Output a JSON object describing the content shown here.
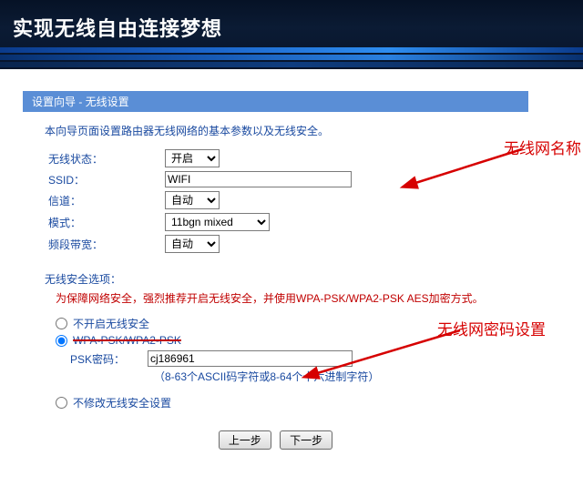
{
  "banner": {
    "slogan": "实现无线自由连接梦想"
  },
  "panel": {
    "title": "设置向导 - 无线设置",
    "intro": "本向导页面设置路由器无线网络的基本参数以及无线安全。"
  },
  "form": {
    "wireless_status_label": "无线状态：",
    "wireless_status_value": "开启",
    "ssid_label": "SSID：",
    "ssid_value": "WIFI",
    "channel_label": "信道：",
    "channel_value": "自动",
    "mode_label": "模式：",
    "mode_value": "11bgn mixed",
    "bandwidth_label": "频段带宽：",
    "bandwidth_value": "自动"
  },
  "security": {
    "title": "无线安全选项：",
    "warning": "为保障网络安全，强烈推荐开启无线安全，并使用WPA-PSK/WPA2-PSK AES加密方式。",
    "opt_none": "不开启无线安全",
    "opt_wpa": "WPA-PSK/WPA2-PSK",
    "psk_label": "PSK密码：",
    "psk_value": "cj186961",
    "psk_hint": "（8-63个ASCII码字符或8-64个十六进制字符）",
    "opt_keep": "不修改无线安全设置"
  },
  "buttons": {
    "prev": "上一步",
    "next": "下一步"
  },
  "annotations": {
    "ssid_hint": "无线网名称",
    "psk_hint": "无线网密码设置"
  }
}
